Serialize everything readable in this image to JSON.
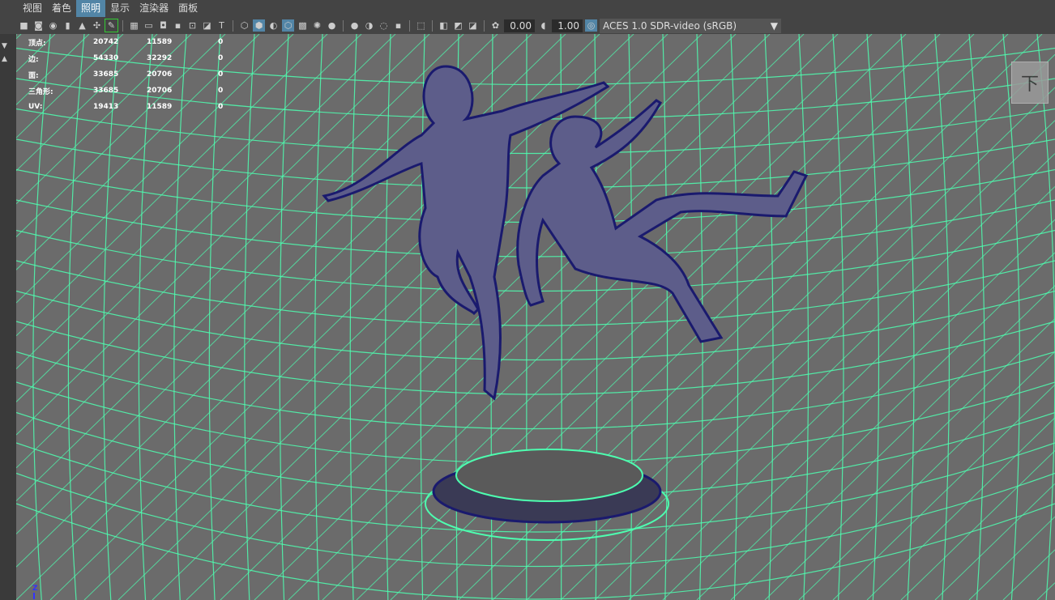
{
  "menu": [
    "视图",
    "着色",
    "照明",
    "显示",
    "渲染器",
    "面板"
  ],
  "active_menu": "照明",
  "toolbar": {
    "exposure": "0.00",
    "gamma": "1.00",
    "color_space": "ACES 1.0 SDR-video (sRGB)"
  },
  "hud": {
    "rows": [
      {
        "label": "顶点:",
        "a": "20742",
        "b": "11589",
        "c": "0"
      },
      {
        "label": "边:",
        "a": "54330",
        "b": "32292",
        "c": "0"
      },
      {
        "label": "面:",
        "a": "33685",
        "b": "20706",
        "c": "0"
      },
      {
        "label": "三角形:",
        "a": "33685",
        "b": "20706",
        "c": "0"
      },
      {
        "label": "UV:",
        "a": "19413",
        "b": "11589",
        "c": "0"
      }
    ]
  },
  "view_cube": "下",
  "axis_label": "Z",
  "colors": {
    "grid": "#4dffb0",
    "mesh": "#1a1a6e",
    "accent": "#5285a6"
  }
}
